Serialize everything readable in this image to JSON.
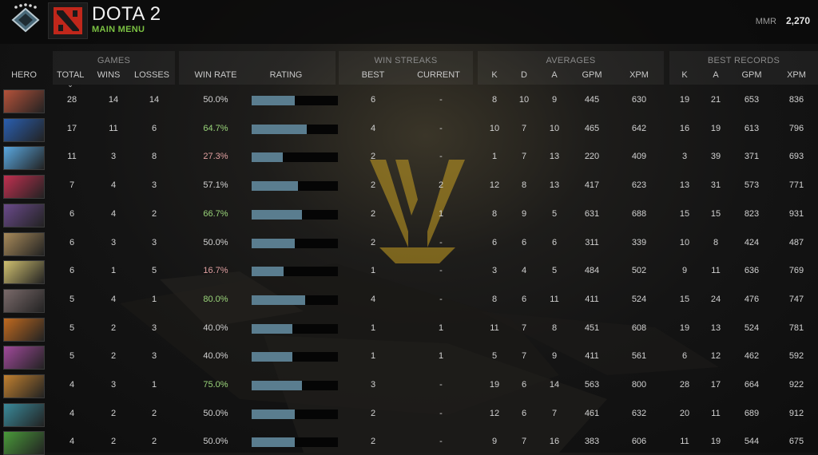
{
  "header": {
    "title": "DOTA 2",
    "subtitle": "MAIN MENU",
    "mmr_label": "MMR",
    "mmr_value": "2,270"
  },
  "groups": {
    "games": "GAMES",
    "win_streaks": "WIN STREAKS",
    "averages": "AVERAGES",
    "best_records": "BEST RECORDS"
  },
  "columns": {
    "hero": "HERO",
    "total": "TOTAL",
    "wins": "WINS",
    "losses": "LOSSES",
    "win_rate": "WIN RATE",
    "rating": "RATING",
    "best": "BEST",
    "current": "CURRENT",
    "avg_k": "K",
    "avg_d": "D",
    "avg_a": "A",
    "avg_gpm": "GPM",
    "avg_xpm": "XPM",
    "best_k": "K",
    "best_a": "A",
    "best_gpm": "GPM",
    "best_xpm": "XPM"
  },
  "colors": {
    "accent_green": "#7bc142",
    "winrate_good": "#9ad57a",
    "winrate_bad": "#e0a0a0",
    "winrate_neutral": "#d2d2d2",
    "bar": "#5a7d8f"
  },
  "rows": [
    {
      "portrait": "#b5523a",
      "total": "28",
      "wins": "14",
      "losses": "14",
      "win_rate": "50.0%",
      "tone": "neutral",
      "rating": 0.5,
      "best": "6",
      "current": "-",
      "k": "8",
      "d": "10",
      "a": "9",
      "gpm": "445",
      "xpm": "630",
      "bk": "19",
      "ba": "21",
      "bgpm": "653",
      "bxpm": "836"
    },
    {
      "portrait": "#2a5fb0",
      "total": "17",
      "wins": "11",
      "losses": "6",
      "win_rate": "64.7%",
      "tone": "good",
      "rating": 0.64,
      "best": "4",
      "current": "-",
      "k": "10",
      "d": "7",
      "a": "10",
      "gpm": "465",
      "xpm": "642",
      "bk": "16",
      "ba": "19",
      "bgpm": "613",
      "bxpm": "796"
    },
    {
      "portrait": "#5aa8e0",
      "total": "11",
      "wins": "3",
      "losses": "8",
      "win_rate": "27.3%",
      "tone": "bad",
      "rating": 0.36,
      "best": "2",
      "current": "-",
      "k": "1",
      "d": "7",
      "a": "13",
      "gpm": "220",
      "xpm": "409",
      "bk": "3",
      "ba": "39",
      "bgpm": "371",
      "bxpm": "693"
    },
    {
      "portrait": "#c03050",
      "total": "7",
      "wins": "4",
      "losses": "3",
      "win_rate": "57.1%",
      "tone": "neutral",
      "rating": 0.54,
      "best": "2",
      "current": "2",
      "k": "12",
      "d": "8",
      "a": "13",
      "gpm": "417",
      "xpm": "623",
      "bk": "13",
      "ba": "31",
      "bgpm": "573",
      "bxpm": "771"
    },
    {
      "portrait": "#6a4a8a",
      "total": "6",
      "wins": "4",
      "losses": "2",
      "win_rate": "66.7%",
      "tone": "good",
      "rating": 0.58,
      "best": "2",
      "current": "1",
      "k": "8",
      "d": "9",
      "a": "5",
      "gpm": "631",
      "xpm": "688",
      "bk": "15",
      "ba": "15",
      "bgpm": "823",
      "bxpm": "931"
    },
    {
      "portrait": "#a88a5a",
      "total": "6",
      "wins": "3",
      "losses": "3",
      "win_rate": "50.0%",
      "tone": "neutral",
      "rating": 0.5,
      "best": "2",
      "current": "-",
      "k": "6",
      "d": "6",
      "a": "6",
      "gpm": "311",
      "xpm": "339",
      "bk": "10",
      "ba": "8",
      "bgpm": "424",
      "bxpm": "487"
    },
    {
      "portrait": "#d0c070",
      "total": "6",
      "wins": "1",
      "losses": "5",
      "win_rate": "16.7%",
      "tone": "bad",
      "rating": 0.37,
      "best": "1",
      "current": "-",
      "k": "3",
      "d": "4",
      "a": "5",
      "gpm": "484",
      "xpm": "502",
      "bk": "9",
      "ba": "11",
      "bgpm": "636",
      "bxpm": "769"
    },
    {
      "portrait": "#7a6a6a",
      "total": "5",
      "wins": "4",
      "losses": "1",
      "win_rate": "80.0%",
      "tone": "good",
      "rating": 0.62,
      "best": "4",
      "current": "-",
      "k": "8",
      "d": "6",
      "a": "11",
      "gpm": "411",
      "xpm": "524",
      "bk": "15",
      "ba": "24",
      "bgpm": "476",
      "bxpm": "747"
    },
    {
      "portrait": "#c06a20",
      "total": "5",
      "wins": "2",
      "losses": "3",
      "win_rate": "40.0%",
      "tone": "neutral",
      "rating": 0.47,
      "best": "1",
      "current": "1",
      "k": "11",
      "d": "7",
      "a": "8",
      "gpm": "451",
      "xpm": "608",
      "bk": "19",
      "ba": "13",
      "bgpm": "524",
      "bxpm": "781"
    },
    {
      "portrait": "#a04a9a",
      "total": "5",
      "wins": "2",
      "losses": "3",
      "win_rate": "40.0%",
      "tone": "neutral",
      "rating": 0.47,
      "best": "1",
      "current": "1",
      "k": "5",
      "d": "7",
      "a": "9",
      "gpm": "411",
      "xpm": "561",
      "bk": "6",
      "ba": "12",
      "bgpm": "462",
      "bxpm": "592"
    },
    {
      "portrait": "#c08030",
      "total": "4",
      "wins": "3",
      "losses": "1",
      "win_rate": "75.0%",
      "tone": "good",
      "rating": 0.58,
      "best": "3",
      "current": "-",
      "k": "19",
      "d": "6",
      "a": "14",
      "gpm": "563",
      "xpm": "800",
      "bk": "28",
      "ba": "17",
      "bgpm": "664",
      "bxpm": "922"
    },
    {
      "portrait": "#3a8a9a",
      "total": "4",
      "wins": "2",
      "losses": "2",
      "win_rate": "50.0%",
      "tone": "neutral",
      "rating": 0.5,
      "best": "2",
      "current": "-",
      "k": "12",
      "d": "6",
      "a": "7",
      "gpm": "461",
      "xpm": "632",
      "bk": "20",
      "ba": "11",
      "bgpm": "689",
      "bxpm": "912"
    },
    {
      "portrait": "#4a9a3a",
      "total": "4",
      "wins": "2",
      "losses": "2",
      "win_rate": "50.0%",
      "tone": "neutral",
      "rating": 0.5,
      "best": "2",
      "current": "-",
      "k": "9",
      "d": "7",
      "a": "16",
      "gpm": "383",
      "xpm": "606",
      "bk": "11",
      "ba": "19",
      "bgpm": "544",
      "bxpm": "675"
    }
  ]
}
